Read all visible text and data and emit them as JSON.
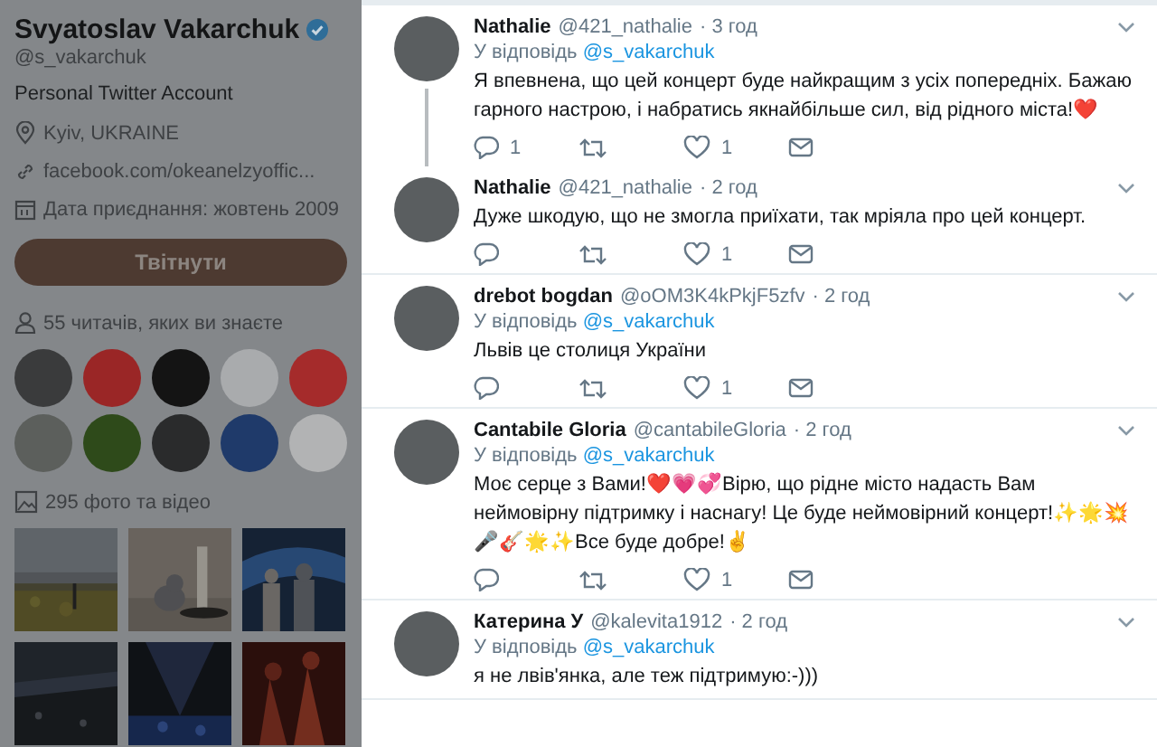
{
  "profile": {
    "name": "Svyatoslav Vakarchuk",
    "verified": true,
    "handle": "@s_vakarchuk",
    "bio": "Personal Twitter Account",
    "location": "Kyiv, UKRAINE",
    "link": "facebook.com/okeanelzyoffic...",
    "joined": "Дата приєднання: жовтень 2009",
    "tweet_button": "Твітнути",
    "followers_known": "55 читачів, яких ви знаєте",
    "follower_avatars": [
      {
        "color": "#3a3b3c"
      },
      {
        "color": "#9a2626"
      },
      {
        "color": "#141414"
      },
      {
        "color": "#a9abad"
      },
      {
        "color": "#a52b2b"
      },
      {
        "color": "#5c5f5c"
      },
      {
        "color": "#2e4a1a"
      },
      {
        "color": "#2a2b2c"
      },
      {
        "color": "#1f3a6a"
      },
      {
        "color": "#b2b3b4"
      }
    ],
    "media_count": "295 фото та відео"
  },
  "tweets": [
    {
      "name": "Nathalie",
      "handle": "@421_nathalie",
      "time": "· 3 год",
      "reply_to": {
        "label": "У відповідь",
        "handle": "@s_vakarchuk"
      },
      "text": "Я впевнена, що цей концерт буде найкращим з усіх попередніх. Бажаю гарного настрою, і набратись якнайбільше сил, від рідного міста!❤️",
      "thread_line": true,
      "actions": {
        "replies": "1",
        "likes": "1"
      }
    },
    {
      "name": "Nathalie",
      "handle": "@421_nathalie",
      "time": "· 2 год",
      "text": "Дуже шкодую, що не змогла приїхати, так мріяла про цей концерт.",
      "thread_line": false,
      "actions": {
        "likes": "1"
      }
    },
    {
      "name": "drebot bogdan",
      "handle": "@oOM3K4kPkjF5zfv",
      "time": "· 2 год",
      "reply_to": {
        "label": "У відповідь",
        "handle": "@s_vakarchuk"
      },
      "text": "Львів це столиця України",
      "thread_line": false,
      "actions": {
        "likes": "1"
      }
    },
    {
      "name": "Cantabile Gloria",
      "handle": "@cantabileGloria",
      "time": "· 2 год",
      "reply_to": {
        "label": "У відповідь",
        "handle": "@s_vakarchuk"
      },
      "text": "Моє серце з Вами!❤️💗💞Вірю, що рідне місто надасть Вам неймовірну підтримку і наснагу! Це буде неймовірний концерт!✨🌟💥🎤🎸🌟✨Все буде добре!✌️",
      "thread_line": false,
      "actions": {
        "likes": "1"
      }
    },
    {
      "name": "Катерина У",
      "handle": "@kalevita1912",
      "time": "· 2 год",
      "reply_to": {
        "label": "У відповідь",
        "handle": "@s_vakarchuk"
      },
      "text": "я не лвів'янка, але теж підтримую:-)))",
      "thread_line": false
    }
  ]
}
